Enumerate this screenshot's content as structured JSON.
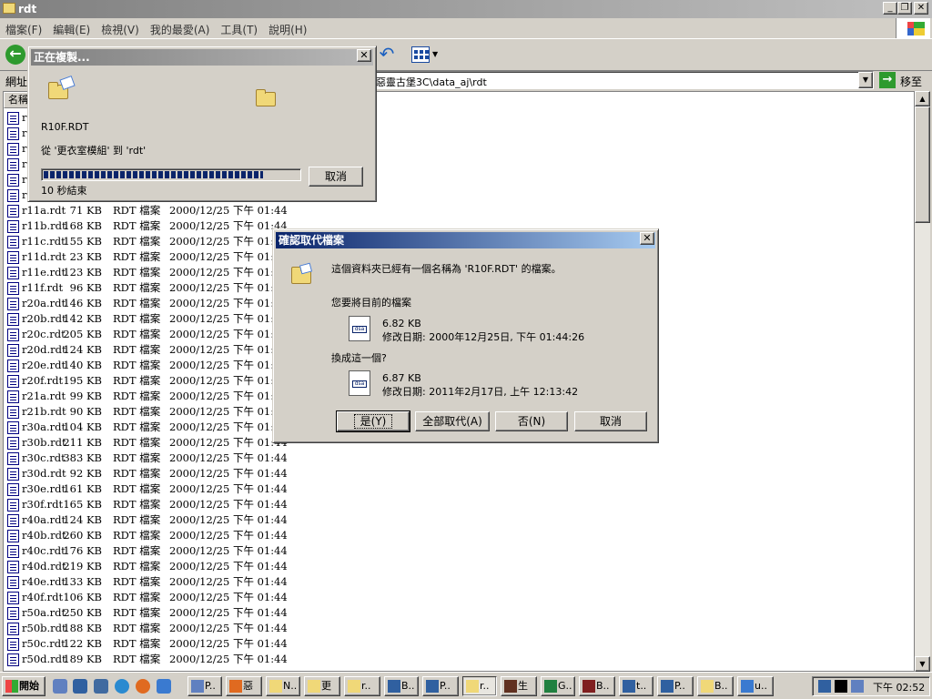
{
  "window": {
    "title": "rdt"
  },
  "menu": [
    "檔案(F)",
    "編輯(E)",
    "檢視(V)",
    "我的最愛(A)",
    "工具(T)",
    "說明(H)"
  ],
  "address": {
    "label": "網址",
    "value": "惡靈古堡3C\\data_aj\\rdt",
    "go_label": "移至"
  },
  "list": {
    "header_name": "名稱",
    "rows": [
      {
        "name": "r1",
        "size": "",
        "type": "",
        "date": ""
      },
      {
        "name": "r1",
        "size": "",
        "type": "",
        "date": ""
      },
      {
        "name": "r1",
        "size": "",
        "type": "",
        "date": ""
      },
      {
        "name": "r1",
        "size": "",
        "type": "",
        "date": ""
      },
      {
        "name": "r1",
        "size": "",
        "type": "",
        "date": ""
      },
      {
        "name": "r1",
        "size": "",
        "type": "",
        "date": ""
      },
      {
        "name": "r11a.rdt",
        "size": "71 KB",
        "type": "RDT 檔案",
        "date": "2000/12/25 下午 01:44"
      },
      {
        "name": "r11b.rdt",
        "size": "168 KB",
        "type": "RDT 檔案",
        "date": "2000/12/25 下午 01:44"
      },
      {
        "name": "r11c.rdt",
        "size": "155 KB",
        "type": "RDT 檔案",
        "date": "2000/12/25 下午 01:44"
      },
      {
        "name": "r11d.rdt",
        "size": "23 KB",
        "type": "RDT 檔案",
        "date": "2000/12/25 下午 01:44"
      },
      {
        "name": "r11e.rdt",
        "size": "123 KB",
        "type": "RDT 檔案",
        "date": "2000/12/25 下午 01:44"
      },
      {
        "name": "r11f.rdt",
        "size": "96 KB",
        "type": "RDT 檔案",
        "date": "2000/12/25 下午 01:44"
      },
      {
        "name": "r20a.rdt",
        "size": "146 KB",
        "type": "RDT 檔案",
        "date": "2000/12/25 下午 01:44"
      },
      {
        "name": "r20b.rdt",
        "size": "142 KB",
        "type": "RDT 檔案",
        "date": "2000/12/25 下午 01:44"
      },
      {
        "name": "r20c.rdt",
        "size": "205 KB",
        "type": "RDT 檔案",
        "date": "2000/12/25 下午 01:44"
      },
      {
        "name": "r20d.rdt",
        "size": "124 KB",
        "type": "RDT 檔案",
        "date": "2000/12/25 下午 01:44"
      },
      {
        "name": "r20e.rdt",
        "size": "140 KB",
        "type": "RDT 檔案",
        "date": "2000/12/25 下午 01:44"
      },
      {
        "name": "r20f.rdt",
        "size": "195 KB",
        "type": "RDT 檔案",
        "date": "2000/12/25 下午 01:44"
      },
      {
        "name": "r21a.rdt",
        "size": "99 KB",
        "type": "RDT 檔案",
        "date": "2000/12/25 下午 01:44"
      },
      {
        "name": "r21b.rdt",
        "size": "90 KB",
        "type": "RDT 檔案",
        "date": "2000/12/25 下午 01:44"
      },
      {
        "name": "r30a.rdt",
        "size": "104 KB",
        "type": "RDT 檔案",
        "date": "2000/12/25 下午 01:44"
      },
      {
        "name": "r30b.rdt",
        "size": "211 KB",
        "type": "RDT 檔案",
        "date": "2000/12/25 下午 01:44"
      },
      {
        "name": "r30c.rdt",
        "size": "383 KB",
        "type": "RDT 檔案",
        "date": "2000/12/25 下午 01:44"
      },
      {
        "name": "r30d.rdt",
        "size": "92 KB",
        "type": "RDT 檔案",
        "date": "2000/12/25 下午 01:44"
      },
      {
        "name": "r30e.rdt",
        "size": "161 KB",
        "type": "RDT 檔案",
        "date": "2000/12/25 下午 01:44"
      },
      {
        "name": "r30f.rdt",
        "size": "165 KB",
        "type": "RDT 檔案",
        "date": "2000/12/25 下午 01:44"
      },
      {
        "name": "r40a.rdt",
        "size": "124 KB",
        "type": "RDT 檔案",
        "date": "2000/12/25 下午 01:44"
      },
      {
        "name": "r40b.rdt",
        "size": "260 KB",
        "type": "RDT 檔案",
        "date": "2000/12/25 下午 01:44"
      },
      {
        "name": "r40c.rdt",
        "size": "176 KB",
        "type": "RDT 檔案",
        "date": "2000/12/25 下午 01:44"
      },
      {
        "name": "r40d.rdt",
        "size": "219 KB",
        "type": "RDT 檔案",
        "date": "2000/12/25 下午 01:44"
      },
      {
        "name": "r40e.rdt",
        "size": "133 KB",
        "type": "RDT 檔案",
        "date": "2000/12/25 下午 01:44"
      },
      {
        "name": "r40f.rdt",
        "size": "106 KB",
        "type": "RDT 檔案",
        "date": "2000/12/25 下午 01:44"
      },
      {
        "name": "r50a.rdt",
        "size": "250 KB",
        "type": "RDT 檔案",
        "date": "2000/12/25 下午 01:44"
      },
      {
        "name": "r50b.rdt",
        "size": "188 KB",
        "type": "RDT 檔案",
        "date": "2000/12/25 下午 01:44"
      },
      {
        "name": "r50c.rdt",
        "size": "122 KB",
        "type": "RDT 檔案",
        "date": "2000/12/25 下午 01:44"
      },
      {
        "name": "r50d.rdt",
        "size": "189 KB",
        "type": "RDT 檔案",
        "date": "2000/12/25 下午 01:44"
      }
    ]
  },
  "copy_dialog": {
    "title": "正在複製...",
    "filename": "R10F.RDT",
    "from_to": "從 '更衣室模組' 到 'rdt'",
    "remaining": "10 秒結束",
    "cancel_label": "取消",
    "progress_fraction": 0.86
  },
  "replace_dialog": {
    "title": "確認取代檔案",
    "message": "這個資料夾已經有一個名稱為 'R10F.RDT' 的檔案。",
    "question_current": "您要將目前的檔案",
    "current_size": "6.82 KB",
    "current_date": "修改日期: 2000年12月25日, 下午 01:44:26",
    "question_new": "換成這一個?",
    "new_size": "6.87 KB",
    "new_date": "修改日期: 2011年2月17日, 上午 12:13:42",
    "buttons": {
      "yes": "是(Y)",
      "yes_all": "全部取代(A)",
      "no": "否(N)",
      "cancel": "取消"
    }
  },
  "taskbar": {
    "start_label": "開始",
    "tasks": [
      "P..",
      "惡",
      "N..",
      "更",
      "r..",
      "B..",
      "P..",
      "r..",
      "生",
      "G..",
      "B..",
      "t..",
      "P..",
      "B..",
      "u.."
    ],
    "clock": "下午 02:52"
  },
  "icons": {
    "back": "back-arrow-icon",
    "undo": "undo-icon",
    "views": "views-icon",
    "windows_logo": "windows-logo-icon",
    "go": "go-arrow-icon"
  }
}
